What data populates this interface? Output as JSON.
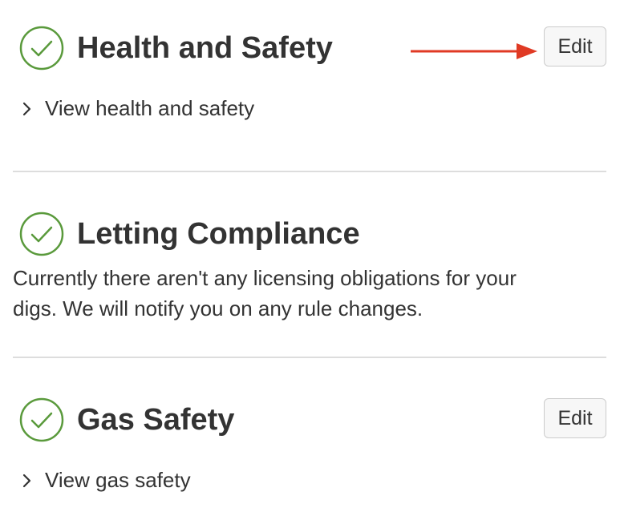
{
  "sections": [
    {
      "title": "Health and Safety",
      "edit_label": "Edit",
      "toggle_label": "View health and safety"
    },
    {
      "title": "Letting Compliance",
      "body": "Currently there aren't any licensing obligations for your digs. We will notify you on any rule changes."
    },
    {
      "title": "Gas Safety",
      "edit_label": "Edit",
      "toggle_label": "View gas safety"
    }
  ],
  "icons": {
    "status": "check-circle-icon",
    "toggle": "chevron-right-icon",
    "annotation": "arrow-right-icon"
  },
  "colors": {
    "check": "#5a9a3c",
    "annotation_arrow": "#e03a24",
    "text": "#333333",
    "divider": "#dddddd"
  }
}
